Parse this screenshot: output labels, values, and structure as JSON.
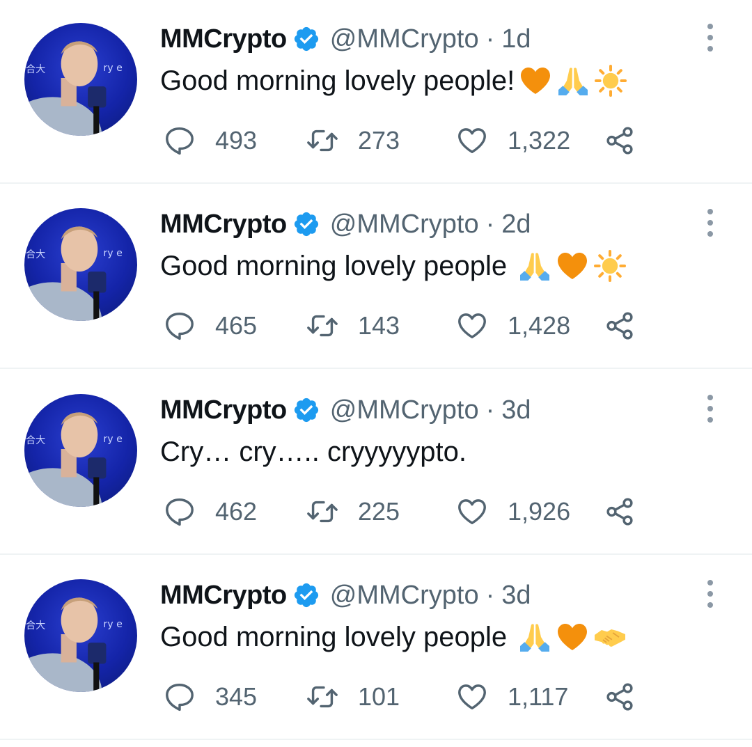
{
  "colors": {
    "verified": "#1d9bf0",
    "muted": "#536471",
    "text": "#0f1419",
    "divider": "#eff3f4"
  },
  "tweets": [
    {
      "name": "MMCrypto",
      "handle": "@MMCrypto",
      "separator": "·",
      "time": "1d",
      "text": "Good morning lovely people!",
      "emojis": [
        "orange-heart",
        "folded-hands",
        "sun"
      ],
      "replies": "493",
      "retweets": "273",
      "likes": "1,322"
    },
    {
      "name": "MMCrypto",
      "handle": "@MMCrypto",
      "separator": "·",
      "time": "2d",
      "text": "Good morning lovely people",
      "emojis": [
        "folded-hands",
        "orange-heart",
        "sun"
      ],
      "replies": "465",
      "retweets": "143",
      "likes": "1,428"
    },
    {
      "name": "MMCrypto",
      "handle": "@MMCrypto",
      "separator": "·",
      "time": "3d",
      "text": "Cry… cry….. cryyyyypto.",
      "emojis": [],
      "replies": "462",
      "retweets": "225",
      "likes": "1,926"
    },
    {
      "name": "MMCrypto",
      "handle": "@MMCrypto",
      "separator": "·",
      "time": "3d",
      "text": "Good morning lovely people",
      "emojis": [
        "folded-hands",
        "orange-heart",
        "handshake"
      ],
      "replies": "345",
      "retweets": "101",
      "likes": "1,117"
    }
  ]
}
